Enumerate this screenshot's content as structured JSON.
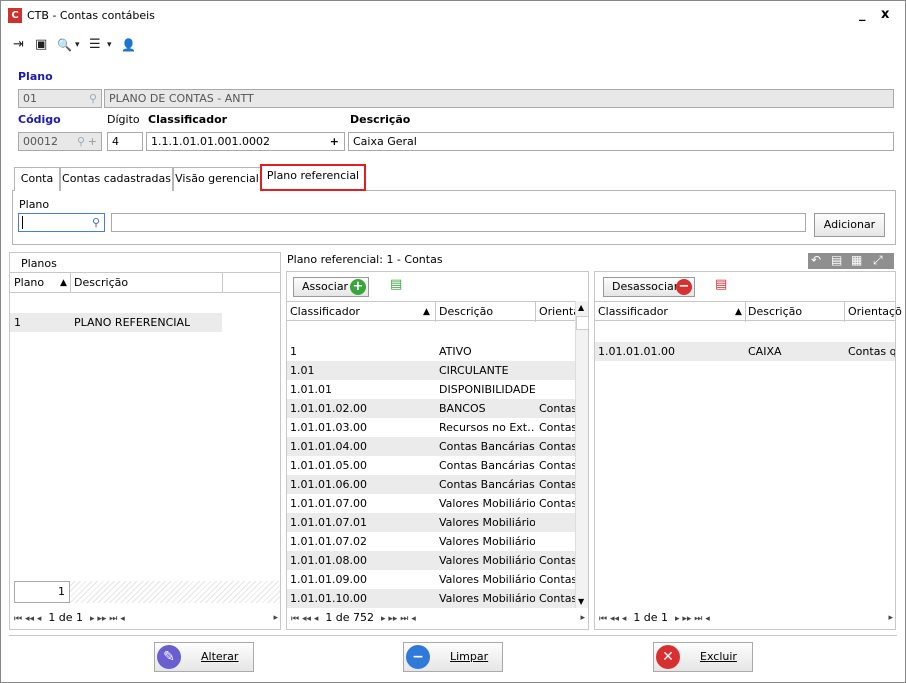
{
  "window": {
    "title": "CTB - Contas contábeis",
    "logo_letter": "C",
    "minimize_label": "_",
    "close_label": "x"
  },
  "toolbar": {
    "icons": [
      "exit-icon",
      "screen-icon",
      "search-icon",
      "list-icon",
      "user-icon"
    ],
    "exit_glyph": "⇥",
    "screen_glyph": "▣",
    "search_glyph": "🔍",
    "list_glyph": "☰",
    "user_glyph": "👤",
    "dropdown_glyph": "▾"
  },
  "form": {
    "plano_label": "Plano",
    "plano_code": "01",
    "plano_name": "PLANO DE CONTAS - ANTT",
    "codigo_label": "Código",
    "codigo_value": "00012",
    "digito_label": "Dígito",
    "digito_value": "4",
    "classificador_label": "Classificador",
    "classificador_value": "1.1.1.01.01.001.0002",
    "descricao_label": "Descrição",
    "descricao_value": "Caixa Geral"
  },
  "tabs": [
    {
      "label": "Conta"
    },
    {
      "label": "Contas cadastradas"
    },
    {
      "label": "Visão gerencial"
    },
    {
      "label": "Plano referencial"
    }
  ],
  "plano_ref": {
    "label": "Plano",
    "input_value": "",
    "description_value": "",
    "add_button": "Adicionar"
  },
  "planos_panel": {
    "title": "Planos",
    "col_plano": "Plano",
    "col_descricao": "Descrição",
    "rows": [
      {
        "plano": "1",
        "descricao": "PLANO REFERENCIAL"
      }
    ],
    "footer_value": "1",
    "pager": "1 de 1"
  },
  "ref_panel": {
    "title": "Plano referencial: 1 - Contas",
    "associar_label": "Associar",
    "col_classificador": "Classificador",
    "col_descricao": "Descrição",
    "col_orientacao": "Orienta",
    "rows": [
      {
        "cls": "1",
        "desc": "ATIVO",
        "ori": ""
      },
      {
        "cls": "1.01",
        "desc": "CIRCULANTE",
        "ori": ""
      },
      {
        "cls": "1.01.01",
        "desc": "DISPONIBILIDADES",
        "ori": ""
      },
      {
        "cls": "1.01.01.02.00",
        "desc": "BANCOS",
        "ori": "Contas"
      },
      {
        "cls": "1.01.01.03.00",
        "desc": "Recursos no Ext…",
        "ori": "Contas"
      },
      {
        "cls": "1.01.01.04.00",
        "desc": "Contas Bancárias…",
        "ori": "Contas"
      },
      {
        "cls": "1.01.01.05.00",
        "desc": "Contas Bancárias…",
        "ori": "Contas"
      },
      {
        "cls": "1.01.01.06.00",
        "desc": "Contas Bancárias…",
        "ori": "Contas"
      },
      {
        "cls": "1.01.01.07.00",
        "desc": "Valores Mobiliários",
        "ori": "Contas"
      },
      {
        "cls": "1.01.01.07.01",
        "desc": "Valores Mobiliário…",
        "ori": ""
      },
      {
        "cls": "1.01.01.07.02",
        "desc": "Valores Mobiliário…",
        "ori": ""
      },
      {
        "cls": "1.01.01.08.00",
        "desc": "Valores Mobiliário…",
        "ori": "Contas"
      },
      {
        "cls": "1.01.01.09.00",
        "desc": "Valores Mobiliário…",
        "ori": "Contas"
      },
      {
        "cls": "1.01.01.10.00",
        "desc": "Valores Mobiliário…",
        "ori": "Contas"
      }
    ],
    "pager": "1 de 752"
  },
  "assoc_panel": {
    "desassociar_label": "Desassociar",
    "col_classificador": "Classificador",
    "col_descricao": "Descrição",
    "col_orientacao": "Orientaçõ",
    "rows": [
      {
        "cls": "1.01.01.01.00",
        "desc": "CAIXA",
        "ori": "Contas qu"
      }
    ],
    "pager": "1 de 1"
  },
  "pager_glyphs": {
    "first": "⏮",
    "prev_page": "◂◂",
    "prev": "◂",
    "next": "▸",
    "next_page": "▸▸",
    "last": "⏭"
  },
  "buttons": {
    "alterar": "Alterar",
    "limpar": "Limpar",
    "excluir": "Excluir"
  },
  "colors": {
    "accent_blue": "#1a1ab0",
    "tab_highlight": "#e02020",
    "add_green": "#3aa53a",
    "remove_red": "#d83030"
  }
}
